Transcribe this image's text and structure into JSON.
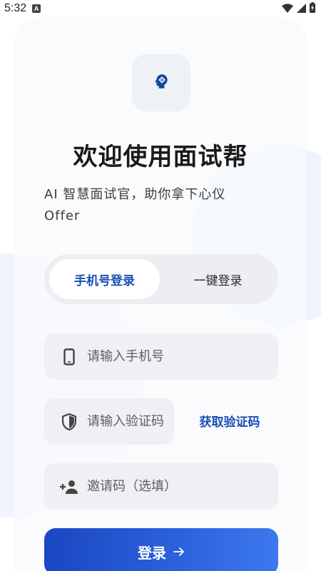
{
  "status_bar": {
    "time": "5:32",
    "notification_badge": "A",
    "icons": [
      "wifi-icon",
      "cellular-signal-icon",
      "battery-charging-icon"
    ]
  },
  "header": {
    "logo_icon": "psychology-head-icon",
    "title": "欢迎使用面试帮",
    "subtitle": "AI 智慧面试官，助你拿下心仪 Offer"
  },
  "tabs": [
    {
      "label": "手机号登录",
      "active": true
    },
    {
      "label": "一键登录",
      "active": false
    }
  ],
  "form": {
    "phone": {
      "placeholder": "请输入手机号",
      "icon": "smartphone-icon"
    },
    "code": {
      "placeholder": "请输入验证码",
      "icon": "shield-icon"
    },
    "get_code_label": "获取验证码",
    "invite": {
      "placeholder": "邀请码（选填）",
      "icon": "person-add-icon"
    }
  },
  "login_button": {
    "label": "登录",
    "icon": "arrow-right-icon"
  },
  "colors": {
    "accent": "#1a4fb4",
    "button_start": "#1a47c2",
    "button_end": "#3d78ee",
    "field_bg": "#eef0f3",
    "tabs_bg": "#eceef1"
  }
}
